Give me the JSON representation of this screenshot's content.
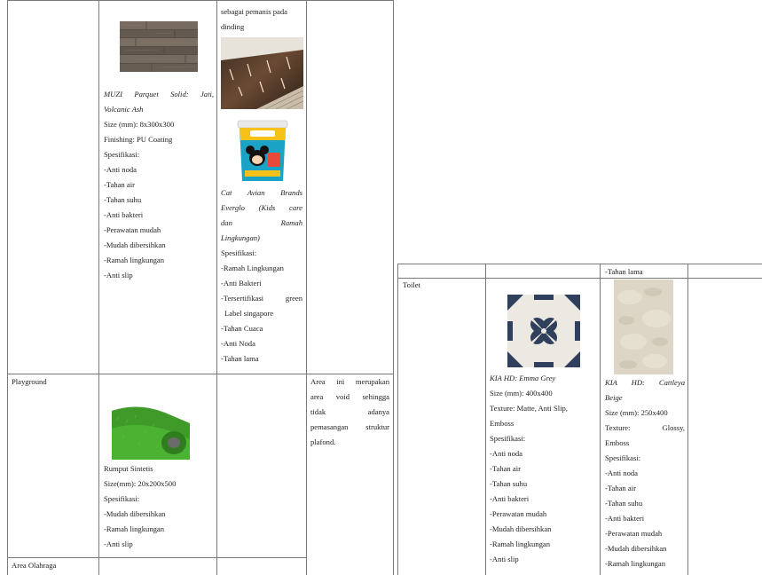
{
  "left_table": {
    "muzi": {
      "name": "MUZI Parquet Solid: Jati, Volcanic Ash",
      "name_line1": "MUZI Parquet Solid: Jati,",
      "name_line2": "Volcanic Ash",
      "size": "Size (mm): 8x300x300",
      "finishing": "Finishing: PU Coating",
      "spec_heading": "Spesifikasi:",
      "specs": [
        "-Anti noda",
        "-Tahan air",
        "-Tahan suhu",
        "-Anti bakteri",
        "-Perawatan mudah",
        "-Mudah dibersihkan",
        "-Ramah lingkungan",
        "-Anti slip"
      ]
    },
    "wall": {
      "intro_line1": "sebagai pemanis pada",
      "intro_line2": "dinding"
    },
    "avian": {
      "name_line1": "Cat Avian Brands",
      "name_line2": "Everglo (Kids care",
      "name_line3a": "dan",
      "name_line3b": "Ramah",
      "name_line4": "Lingkungan)",
      "spec_heading": "Spesifikasi:",
      "specs": [
        "-Ramah Lingkungan",
        "-Anti Bakteri"
      ],
      "spec_green_line1": "-Tersertifikasi green",
      "spec_green_line2": "Label singapore",
      "specs_tail": [
        "-Tahan Cuaca",
        "-Anti Noda",
        "-Tahan lama"
      ]
    },
    "playground": {
      "area": "Playground",
      "product": "Rumput Sintetis",
      "size": "Size(mm): 20x200x500",
      "spec_heading": "Spesifikasi:",
      "specs": [
        "-Mudah dibersihkan",
        "-Ramah lingkungan",
        "-Anti slip"
      ],
      "note_lines": [
        "Area ini merupakan",
        "area void sehingga",
        "tidak adanya",
        "pemasangan struktur",
        "plafond."
      ]
    },
    "olahraga": {
      "area": "Area Olahraga"
    }
  },
  "right_table": {
    "top_text": "-Tahan lama",
    "toilet": {
      "area": "Toilet",
      "emma": {
        "name": "KIA HD: Emma Grey",
        "size": "Size (mm): 400x400",
        "texture_line1": "Texture: Matte, Anti Slip,",
        "texture_line2": "Emboss",
        "spec_heading": "Spesifikasi:",
        "specs": [
          "-Anti noda",
          "-Tahan air",
          "-Tahan suhu",
          "-Anti bakteri",
          "-Perawatan mudah",
          "-Mudah dibersihkan",
          "-Ramah lingkungan",
          "-Anti slip"
        ]
      },
      "cattleya": {
        "name_line1": "KIA HD: Cattleya",
        "name_line2": "Beige",
        "size": "Size (mm): 250x400",
        "texture_line1a": "Texture:",
        "texture_line1b": "Glossy,",
        "texture_line2": "Emboss",
        "spec_heading": "Spesifikasi:",
        "specs": [
          "-Anti noda",
          "-Tahan air",
          "-Tahan suhu",
          "-Anti bakteri",
          "-Perawatan mudah",
          "-Mudah dibersihkan",
          "-Ramah lingkungan"
        ]
      }
    }
  },
  "colors": {
    "grid": "#7a7a7a",
    "text": "#222222",
    "grass": "#3f9a2a",
    "tile_blue": "#2f3f5c"
  }
}
